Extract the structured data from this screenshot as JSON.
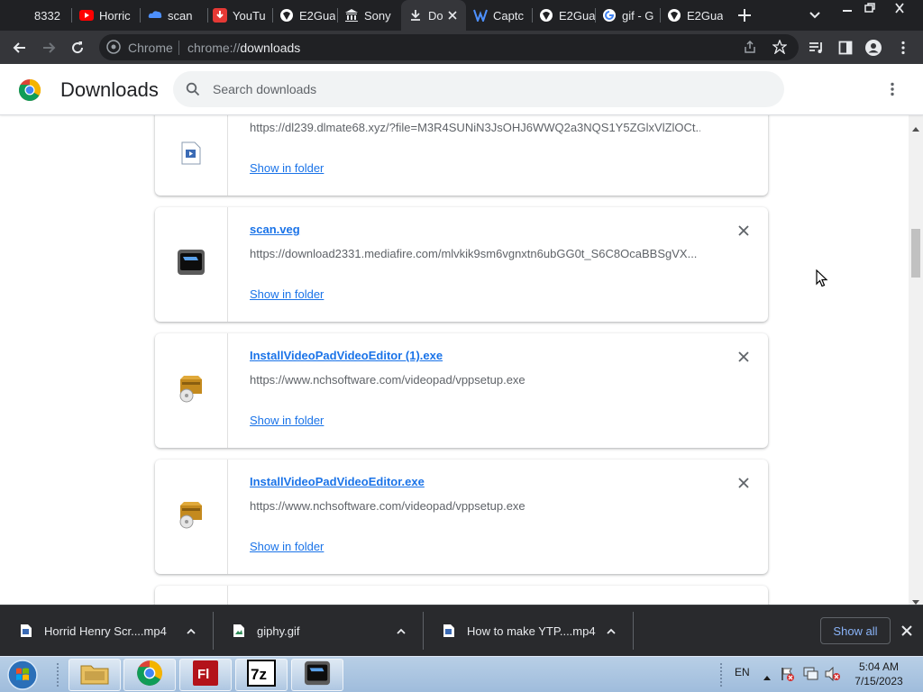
{
  "browser": {
    "tabs": [
      {
        "title": "8332",
        "favicon": "tab-favicon-icon"
      },
      {
        "title": "Horric",
        "favicon": "youtube-icon"
      },
      {
        "title": "scan",
        "favicon": "cloud-icon"
      },
      {
        "title": "YouTu",
        "favicon": "download-site-icon"
      },
      {
        "title": "E2Gua",
        "favicon": "e2guardian-icon"
      },
      {
        "title": "Sony",
        "favicon": "bank-icon"
      },
      {
        "title": "Do",
        "favicon": "download-icon"
      },
      {
        "title": "Captc",
        "favicon": "captcha-icon"
      },
      {
        "title": "E2Gua",
        "favicon": "e2guardian-icon"
      },
      {
        "title": "gif - G",
        "favicon": "google-icon"
      },
      {
        "title": "E2Gua",
        "favicon": "e2guardian-icon"
      }
    ],
    "omnibox": {
      "site_label": "Chrome",
      "url_scheme": "chrome://",
      "url_host": "downloads"
    }
  },
  "page": {
    "title": "Downloads",
    "search_placeholder": "Search downloads"
  },
  "downloads": [
    {
      "filename": "",
      "url": "https://dl239.dlmate68.xyz/?file=M3R4SUNiN3JsOHJ6WWQ2a3NQS1Y5ZGlxVlZlOCt...",
      "action": "Show in folder",
      "icon": "video-file-icon"
    },
    {
      "filename": "scan.veg",
      "url": "https://download2331.mediafire.com/mlvkik9sm6vgnxtn6ubGG0t_S6C8OcaBBSgVX...",
      "action": "Show in folder",
      "icon": "vegas-file-icon"
    },
    {
      "filename": "InstallVideoPadVideoEditor (1).exe",
      "url": "https://www.nchsoftware.com/videopad/vppsetup.exe",
      "action": "Show in folder",
      "icon": "installer-icon"
    },
    {
      "filename": "InstallVideoPadVideoEditor.exe",
      "url": "https://www.nchsoftware.com/videopad/vppsetup.exe",
      "action": "Show in folder",
      "icon": "installer-icon"
    }
  ],
  "shelf": {
    "items": [
      {
        "filename": "Horrid Henry Scr....mp4",
        "icon": "video-file-icon"
      },
      {
        "filename": "giphy.gif",
        "icon": "image-file-icon"
      },
      {
        "filename": "How to make YTP....mp4",
        "icon": "video-file-icon"
      }
    ],
    "show_all_label": "Show all"
  },
  "taskbar": {
    "language": "EN",
    "time": "5:04 AM",
    "date": "7/15/2023"
  },
  "colors": {
    "accent": "#1a73e8",
    "tabstrip": "#202124",
    "toolbar": "#35363a",
    "shelf": "#292a2d"
  }
}
